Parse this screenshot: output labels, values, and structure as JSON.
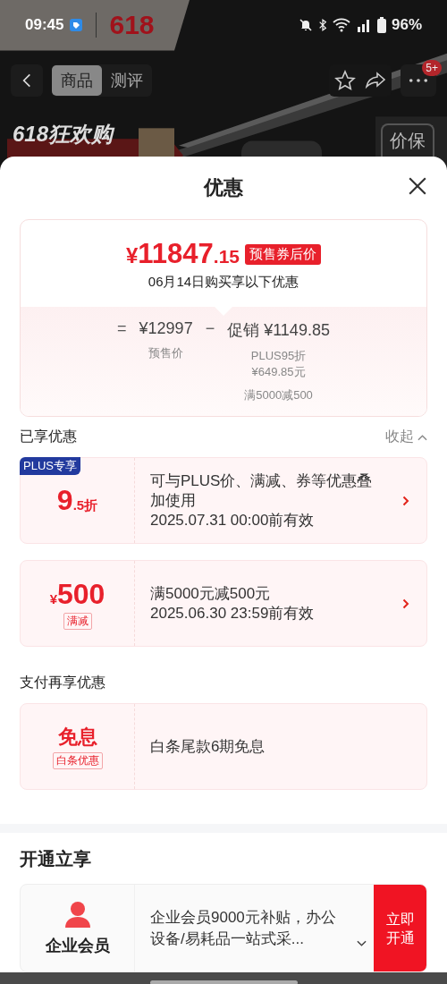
{
  "status_bar": {
    "time": "09:45",
    "battery": "96%"
  },
  "logo": {
    "text": "618"
  },
  "nav": {
    "tabs": [
      {
        "label": "商品",
        "selected": true
      },
      {
        "label": "测评",
        "selected": false
      }
    ],
    "badge": "5+"
  },
  "banner": {
    "title": "618狂欢购",
    "guarantee": "价保"
  },
  "sheet": {
    "title": "优惠",
    "summary": {
      "currency": "¥",
      "integer": "11847",
      "decimal": ".15",
      "tag": "预售券后价",
      "subtitle": "06月14日购买享以下优惠",
      "terms": [
        {
          "kind": "operator",
          "text": "="
        },
        {
          "kind": "amount",
          "text": "¥12997",
          "notes": [
            "预售价"
          ]
        },
        {
          "kind": "operator",
          "text": "−"
        },
        {
          "kind": "amount",
          "text": "促销 ¥1149.85",
          "notes": [
            "PLUS95折\n¥649.85元",
            "满5000减500"
          ]
        }
      ]
    },
    "sections": [
      {
        "heading": "已享优惠",
        "action": "收起",
        "coupons": [
          {
            "kind": "discount",
            "corner": "PLUS专享",
            "value": "9",
            "suffix": ".5折",
            "lines": [
              "可与PLUS价、满减、券等优惠叠加使用",
              "2025.07.31 00:00前有效"
            ],
            "arrow": true
          },
          {
            "kind": "amount",
            "prefix": "¥",
            "value": "500",
            "tag": "满减",
            "lines": [
              "满5000元减500元",
              "2025.06.30 23:59前有效"
            ],
            "arrow": true
          }
        ]
      },
      {
        "heading": "支付再享优惠",
        "coupons": [
          {
            "kind": "text",
            "value": "免息",
            "tag": "白条优惠",
            "lines": [
              "白条尾款6期免息"
            ],
            "arrow": false
          }
        ]
      }
    ],
    "membership": {
      "heading": "开通立享",
      "name": "企业会员",
      "description": "企业会员9000元补贴，办公设备/易耗品一站式采...",
      "button": "立即开通"
    }
  }
}
